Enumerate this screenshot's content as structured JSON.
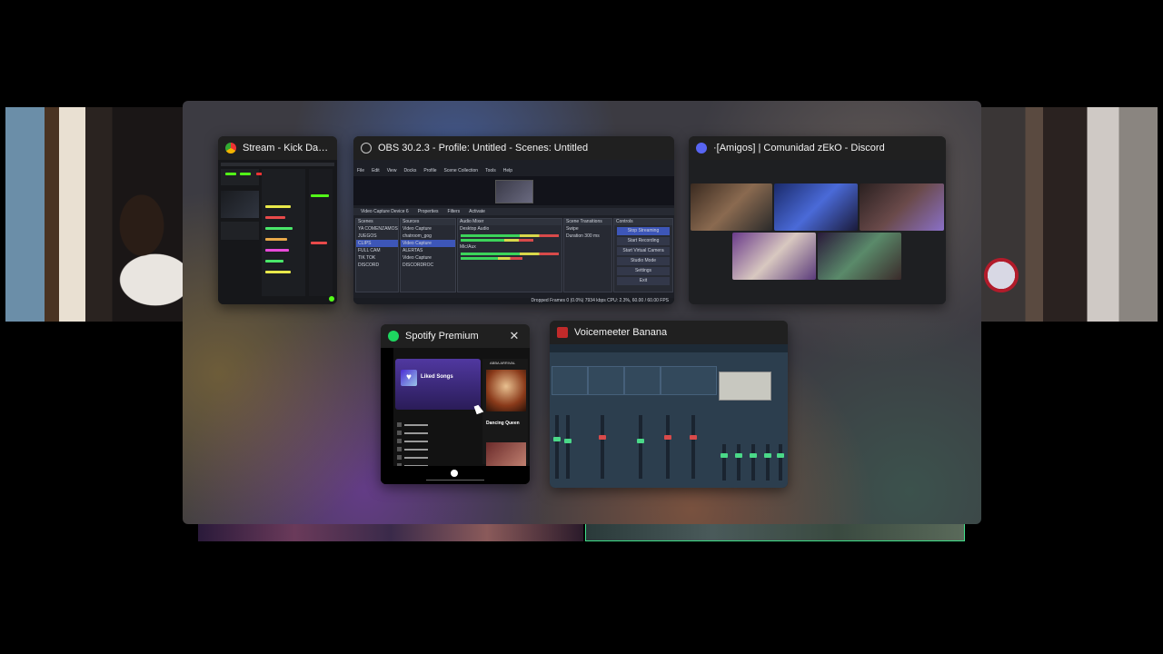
{
  "windows": {
    "kick": {
      "title": "Stream - Kick Dashboard...",
      "icon": "chrome-icon"
    },
    "obs": {
      "title": "OBS 30.2.3 - Profile: Untitled - Scenes: Untitled",
      "icon": "obs-icon",
      "menu": [
        "File",
        "Edit",
        "View",
        "Docks",
        "Profile",
        "Scene Collection",
        "Tools",
        "Help"
      ],
      "props": [
        "Video Capture Device 6",
        "Properties",
        "Filters",
        "Activate"
      ],
      "scenes": [
        "YA COMENZAMOS",
        "JUEGOS",
        "CLIPS",
        "FULL CAM",
        "TIK TOK",
        "DISCORD"
      ],
      "sources": [
        "Video Capture",
        "chatroom_gog",
        "Video Capture",
        "ALERTAS",
        "Video Capture",
        "DISCORDROC"
      ],
      "mixer": [
        "Desktop Audio",
        "Mic/Aux"
      ],
      "transition": [
        "Swipe",
        "Duration",
        "300 ms"
      ],
      "controls": [
        "Stop Streaming",
        "Start Recording",
        "Start Virtual Camera",
        "Studio Mode",
        "Settings",
        "Exit"
      ],
      "docks": [
        "Scenes",
        "Sources",
        "Audio Mixer",
        "Scene Transitions",
        "Controls"
      ],
      "status": "Dropped Frames 0 (0.0%)   7934 kbps   CPU: 2.3%, 60.00 / 60.00 FPS"
    },
    "discord": {
      "title": "·[Amigos] | Comunidad zEkO - Discord",
      "icon": "discord-icon"
    },
    "spotify": {
      "title": "Spotify Premium",
      "icon": "spotify-icon",
      "playlist": "Liked Songs",
      "now_playing_title": "Dancing Queen",
      "now_playing_header": "ABBA ARRIVAL"
    },
    "voicemeeter": {
      "title": "Voicemeeter Banana",
      "icon": "voicemeeter-icon"
    }
  },
  "colors": {
    "chrome": "#f3b400",
    "obs": "#c8c8c8",
    "discord": "#5865f2",
    "spotify": "#1ed760",
    "voicemeeter": "#c02a2a"
  }
}
